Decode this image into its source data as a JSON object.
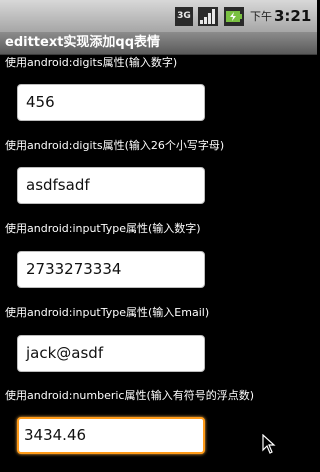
{
  "status_bar": {
    "network_type": "3G",
    "time_prefix": "下午",
    "time": "3:21",
    "icons": [
      "3g-icon",
      "signal-icon",
      "battery-charging-icon"
    ]
  },
  "app": {
    "title": "edittext实现添加qq表情"
  },
  "fields": [
    {
      "label": "使用android:digits属性(输入数字)",
      "value": "456"
    },
    {
      "label": "使用android:digits属性(输入26个小写字母)",
      "value": "asdfsadf"
    },
    {
      "label": "使用android:inputType属性(输入数字)",
      "value": "2733273334"
    },
    {
      "label": "使用android:inputType属性(输入Email)",
      "value": "jack@asdf"
    },
    {
      "label": "使用android:numberic属性(输入有符号的浮点数)",
      "value": "3434.46"
    }
  ],
  "colors": {
    "background": "#000000",
    "focus_border": "#ff9b19",
    "title_bar": "#6e6e6e"
  }
}
